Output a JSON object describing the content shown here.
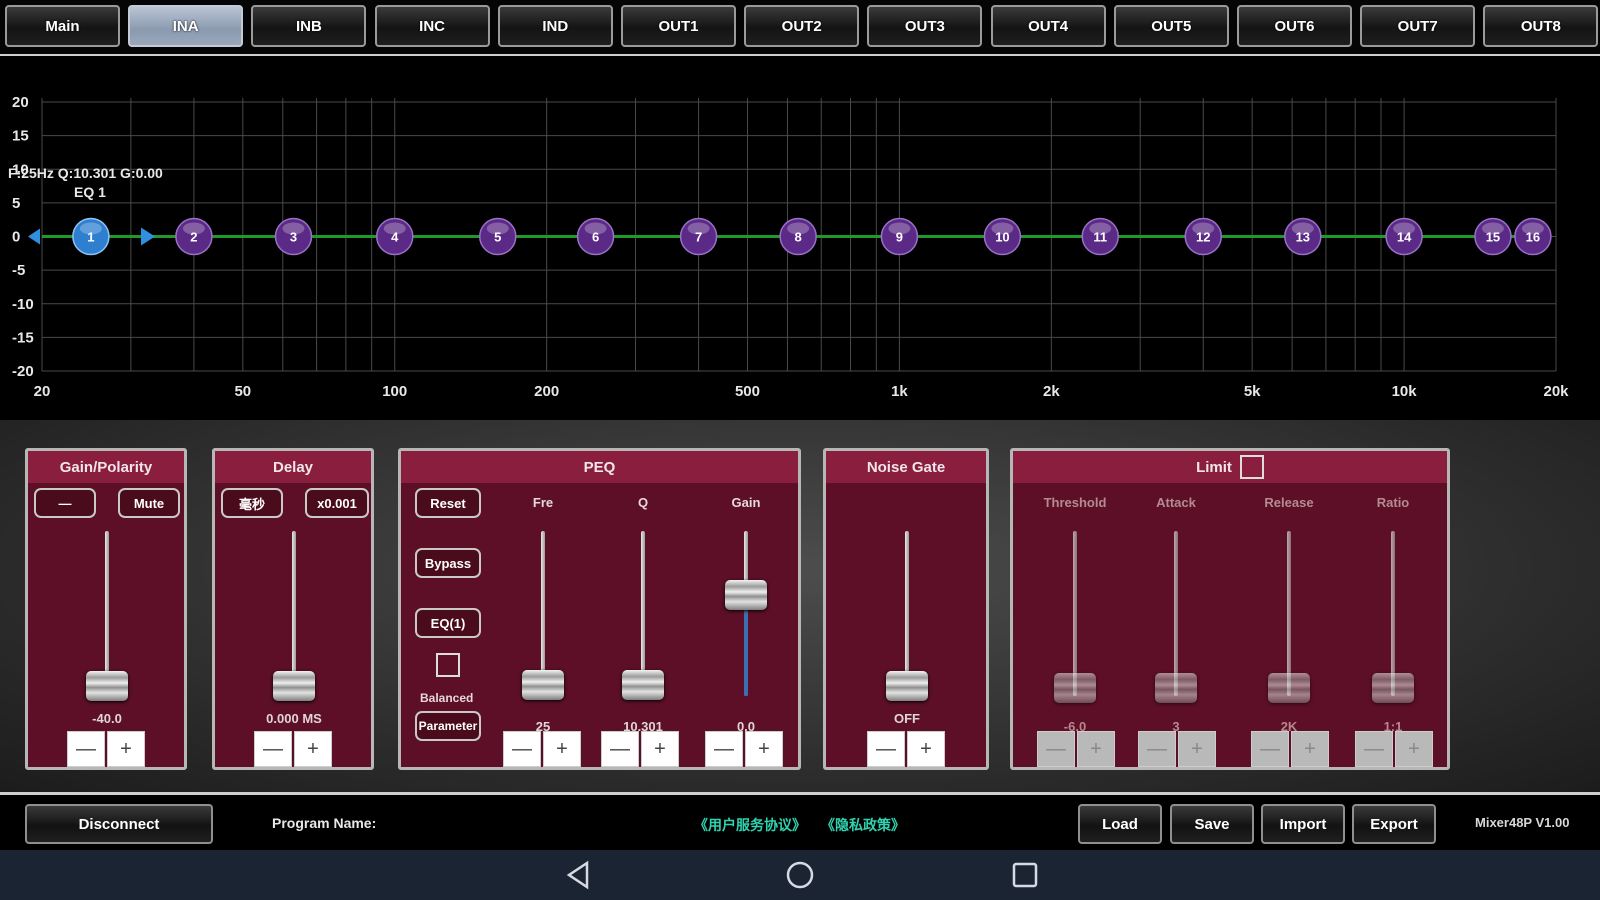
{
  "tabs": [
    {
      "label": "Main",
      "active": false
    },
    {
      "label": "INA",
      "active": true
    },
    {
      "label": "INB",
      "active": false
    },
    {
      "label": "INC",
      "active": false
    },
    {
      "label": "IND",
      "active": false
    },
    {
      "label": "OUT1",
      "active": false
    },
    {
      "label": "OUT2",
      "active": false
    },
    {
      "label": "OUT3",
      "active": false
    },
    {
      "label": "OUT4",
      "active": false
    },
    {
      "label": "OUT5",
      "active": false
    },
    {
      "label": "OUT6",
      "active": false
    },
    {
      "label": "OUT7",
      "active": false
    },
    {
      "label": "OUT8",
      "active": false
    }
  ],
  "eq_graph": {
    "info_line1": "F:25Hz Q:10.301 G:0.00",
    "info_line2": "EQ 1",
    "y_ticks": [
      "20",
      "15",
      "10",
      "5",
      "0",
      "-5",
      "-10",
      "-15",
      "-20"
    ],
    "y_values": [
      20,
      15,
      10,
      5,
      0,
      -5,
      -10,
      -15,
      -20
    ],
    "x_ticks": [
      "20",
      "50",
      "100",
      "200",
      "500",
      "1k",
      "2k",
      "5k",
      "10k",
      "20k"
    ],
    "x_values": [
      20,
      50,
      100,
      200,
      500,
      1000,
      2000,
      5000,
      10000,
      20000
    ],
    "nodes": [
      {
        "label": "1",
        "freq": 25,
        "gain": 0,
        "selected": true
      },
      {
        "label": "2",
        "freq": 40,
        "gain": 0
      },
      {
        "label": "3",
        "freq": 63,
        "gain": 0
      },
      {
        "label": "4",
        "freq": 100,
        "gain": 0
      },
      {
        "label": "5",
        "freq": 160,
        "gain": 0
      },
      {
        "label": "6",
        "freq": 250,
        "gain": 0
      },
      {
        "label": "7",
        "freq": 400,
        "gain": 0
      },
      {
        "label": "8",
        "freq": 630,
        "gain": 0
      },
      {
        "label": "9",
        "freq": 1000,
        "gain": 0
      },
      {
        "label": "10",
        "freq": 1600,
        "gain": 0
      },
      {
        "label": "11",
        "freq": 2500,
        "gain": 0
      },
      {
        "label": "12",
        "freq": 4000,
        "gain": 0
      },
      {
        "label": "13",
        "freq": 6300,
        "gain": 0
      },
      {
        "label": "14",
        "freq": 10000,
        "gain": 0
      },
      {
        "label": "15",
        "freq": 15000,
        "gain": 0
      },
      {
        "label": "16",
        "freq": 18000,
        "gain": 0
      }
    ],
    "curve_color": "#1f9a2a",
    "node_color": "#5b2a86",
    "selected_node_color": "#2f7fd0"
  },
  "gain_panel": {
    "title": "Gain/Polarity",
    "polarity_label": "—",
    "mute_label": "Mute",
    "value": "-40.0",
    "fader_level": 0.0,
    "minus": "—",
    "plus": "+"
  },
  "delay_panel": {
    "title": "Delay",
    "unit_label": "毫秒",
    "step_label": "x0.001",
    "value": "0.000 MS",
    "fader_level": 0.0,
    "minus": "—",
    "plus": "+"
  },
  "peq_panel": {
    "title": "PEQ",
    "reset_label": "Reset",
    "bypass_label": "Bypass",
    "eq_label": "EQ(1)",
    "balanced_label": "Balanced",
    "mode_label": "Parameter",
    "headers": [
      "Fre",
      "Q",
      "Gain"
    ],
    "values": [
      "25",
      "10.301",
      "0.0"
    ],
    "fader_levels": [
      0.02,
      0.02,
      0.62
    ],
    "minus": "—",
    "plus": "+"
  },
  "noise_gate_panel": {
    "title": "Noise Gate",
    "value": "OFF",
    "fader_level": 0.0,
    "minus": "—",
    "plus": "+"
  },
  "limit_panel": {
    "title": "Limit",
    "headers": [
      "Threshold",
      "Attack",
      "Release",
      "Ratio"
    ],
    "values": [
      "-6.0",
      "3",
      "2K",
      "1:1"
    ],
    "fader_levels": [
      0.0,
      0.0,
      0.0,
      0.0
    ],
    "minus": "—",
    "plus": "+"
  },
  "statusbar": {
    "connection": "Disconnect",
    "program_label": "Program Name:",
    "agreement_link": "《用户服务协议》",
    "privacy_link": "《隐私政策》",
    "load": "Load",
    "save": "Save",
    "import": "Import",
    "export": "Export",
    "version": "Mixer48P V1.00"
  },
  "navbar": {
    "back_icon": "triangle-left",
    "home_icon": "circle",
    "recents_icon": "square"
  }
}
